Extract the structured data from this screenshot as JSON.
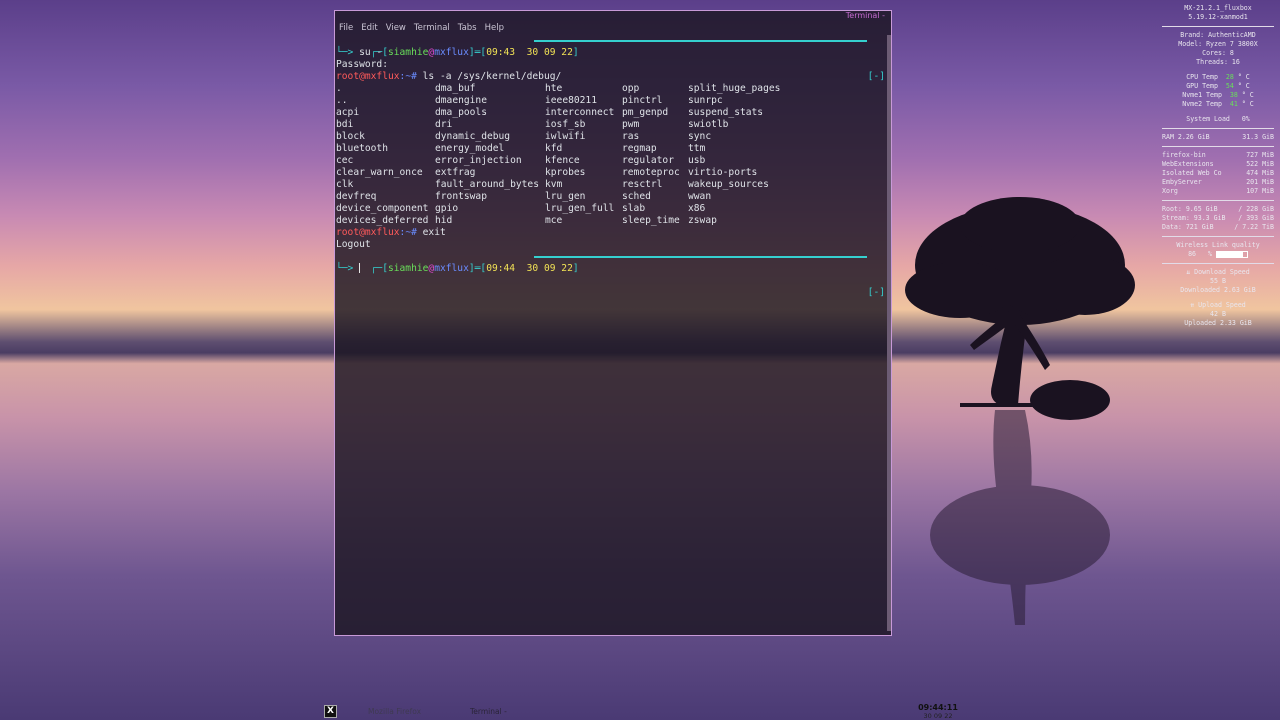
{
  "terminal": {
    "title": "Terminal -",
    "menu": [
      "File",
      "Edit",
      "View",
      "Terminal",
      "Tabs",
      "Help"
    ],
    "prompt1": {
      "user": "siamhie",
      "at": "@",
      "host": "mxflux",
      "time": "09:43",
      "date": "30 09 22",
      "cmd": "su -"
    },
    "password_label": "Password:",
    "root_prompt1": {
      "user": "root@mxflux",
      "path": ":~#",
      "cmd": " ls -a /sys/kernel/debug/"
    },
    "listing": [
      [
        ".",
        "dma_buf",
        "hte",
        "opp",
        "split_huge_pages"
      ],
      [
        "..",
        "dmaengine",
        "ieee80211",
        "pinctrl",
        "sunrpc"
      ],
      [
        "acpi",
        "dma_pools",
        "interconnect",
        "pm_genpd",
        "suspend_stats"
      ],
      [
        "bdi",
        "dri",
        "iosf_sb",
        "pwm",
        "swiotlb"
      ],
      [
        "block",
        "dynamic_debug",
        "iwlwifi",
        "ras",
        "sync"
      ],
      [
        "bluetooth",
        "energy_model",
        "kfd",
        "regmap",
        "ttm"
      ],
      [
        "cec",
        "error_injection",
        "kfence",
        "regulator",
        "usb"
      ],
      [
        "clear_warn_once",
        "extfrag",
        "kprobes",
        "remoteproc",
        "virtio-ports"
      ],
      [
        "clk",
        "fault_around_bytes",
        "kvm",
        "resctrl",
        "wakeup_sources"
      ],
      [
        "devfreq",
        "frontswap",
        "lru_gen",
        "sched",
        "wwan"
      ],
      [
        "device_component",
        "gpio",
        "lru_gen_full",
        "slab",
        "x86"
      ],
      [
        "devices_deferred",
        "hid",
        "mce",
        "sleep_time",
        "zswap"
      ]
    ],
    "root_prompt2": {
      "user": "root@mxflux",
      "path": ":~#",
      "cmd": " exit"
    },
    "logout": "Logout",
    "prompt2": {
      "user": "siamhie",
      "at": "@",
      "host": "mxflux",
      "time": "09:44",
      "date": "30 09 22"
    },
    "end_tag": "[-]"
  },
  "conky": {
    "distro": "MX-21.2.1_fluxbox",
    "kernel": "5.19.12-xanmod1",
    "brand": "Brand:  AuthenticAMD",
    "model": "Model:  Ryzen 7 3800X",
    "cores": "Cores:  8",
    "threads": "Threads:  16",
    "temps": [
      {
        "label": "CPU Temp",
        "value": "28",
        "unit": "° C"
      },
      {
        "label": "GPU Temp",
        "value": "54",
        "unit": "° C"
      },
      {
        "label": "Nvme1 Temp",
        "value": "38",
        "unit": "° C"
      },
      {
        "label": "Nvme2 Temp",
        "value": "41",
        "unit": "° C"
      }
    ],
    "system_load": {
      "label": "System Load",
      "value": "0%"
    },
    "ram": {
      "label": "RAM  2.26 GiB",
      "value": "31.3 GiB"
    },
    "processes": [
      {
        "name": "firefox-bin",
        "mem": "727 MiB"
      },
      {
        "name": "WebExtensions",
        "mem": "522 MiB"
      },
      {
        "name": "Isolated Web Co",
        "mem": "474 MiB"
      },
      {
        "name": "EmbyServer",
        "mem": "201 MiB"
      },
      {
        "name": "Xorg",
        "mem": "107 MiB"
      }
    ],
    "disks": [
      {
        "label": "Root:   9.65 GiB",
        "value": "/ 228 GiB"
      },
      {
        "label": "Stream: 93.3 GiB",
        "value": "/ 393 GiB"
      },
      {
        "label": "Data:   721 GiB",
        "value": "/ 7.22 TiB"
      }
    ],
    "wifi": {
      "label": "Wireless Link quality",
      "value": "86",
      "unit": "%",
      "fraction": 0.86
    },
    "download": {
      "label": "⇊ Download Speed",
      "speed": "55 B",
      "total": "Downloaded 2.63 GiB"
    },
    "upload": {
      "label": "⇈ Upload Speed",
      "speed": "42 B",
      "total": "Uploaded 2.33 GiB"
    }
  },
  "taskbar": {
    "start_glyph": "X",
    "tasks": [
      "Mozilla Firefox",
      "Terminal -"
    ],
    "time": "09:44:11",
    "date": "30 09 22"
  }
}
